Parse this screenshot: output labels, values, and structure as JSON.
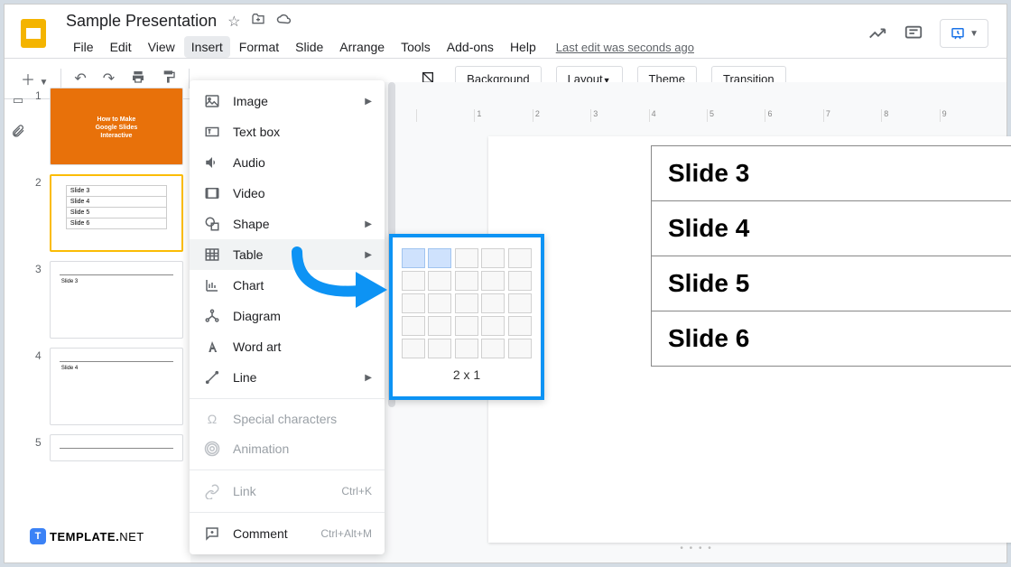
{
  "doc": {
    "title": "Sample Presentation",
    "last_edit": "Last edit was seconds ago"
  },
  "menubar": [
    "File",
    "Edit",
    "View",
    "Insert",
    "Format",
    "Slide",
    "Arrange",
    "Tools",
    "Add-ons",
    "Help"
  ],
  "active_menu_index": 3,
  "canvas_toolbar": {
    "background": "Background",
    "layout": "Layout",
    "theme": "Theme",
    "transition": "Transition"
  },
  "ruler": [
    "",
    "1",
    "2",
    "3",
    "4",
    "5",
    "6",
    "7",
    "8",
    "9"
  ],
  "thumbs": {
    "t1_text": "How to Make\nGoogle Slides\nInteractive",
    "t2_rows": [
      "Slide 3",
      "Slide 4",
      "Slide 5",
      "Slide 6"
    ],
    "t3_label": "Slide 3",
    "t4_label": "Slide 4"
  },
  "dropdown": {
    "items": [
      {
        "icon": "image",
        "label": "Image",
        "arrow": true
      },
      {
        "icon": "textbox",
        "label": "Text box"
      },
      {
        "icon": "audio",
        "label": "Audio"
      },
      {
        "icon": "video",
        "label": "Video"
      },
      {
        "icon": "shape",
        "label": "Shape",
        "arrow": true
      },
      {
        "icon": "table",
        "label": "Table",
        "arrow": true,
        "hover": true
      },
      {
        "icon": "chart",
        "label": "Chart",
        "arrow": true
      },
      {
        "icon": "diagram",
        "label": "Diagram"
      },
      {
        "icon": "wordart",
        "label": "Word art"
      },
      {
        "icon": "line",
        "label": "Line",
        "arrow": true
      }
    ],
    "sep_after": 9,
    "disabled": [
      {
        "icon": "omega",
        "label": "Special characters"
      },
      {
        "icon": "anim",
        "label": "Animation"
      }
    ],
    "sep_after2": true,
    "link": {
      "icon": "link",
      "label": "Link",
      "shortcut": "Ctrl+K",
      "disabled": true
    },
    "comment": {
      "icon": "comment",
      "label": "Comment",
      "shortcut": "Ctrl+Alt+M"
    }
  },
  "table_popup": {
    "label": "2 x 1",
    "cols": 5,
    "rows": 5,
    "hl_cols": 2,
    "hl_rows": 1
  },
  "slide_content": [
    "Slide 3",
    "Slide 4",
    "Slide 5",
    "Slide 6"
  ],
  "watermark": {
    "t": "TEMPLATE",
    "dot": ".",
    "net": "NET"
  }
}
